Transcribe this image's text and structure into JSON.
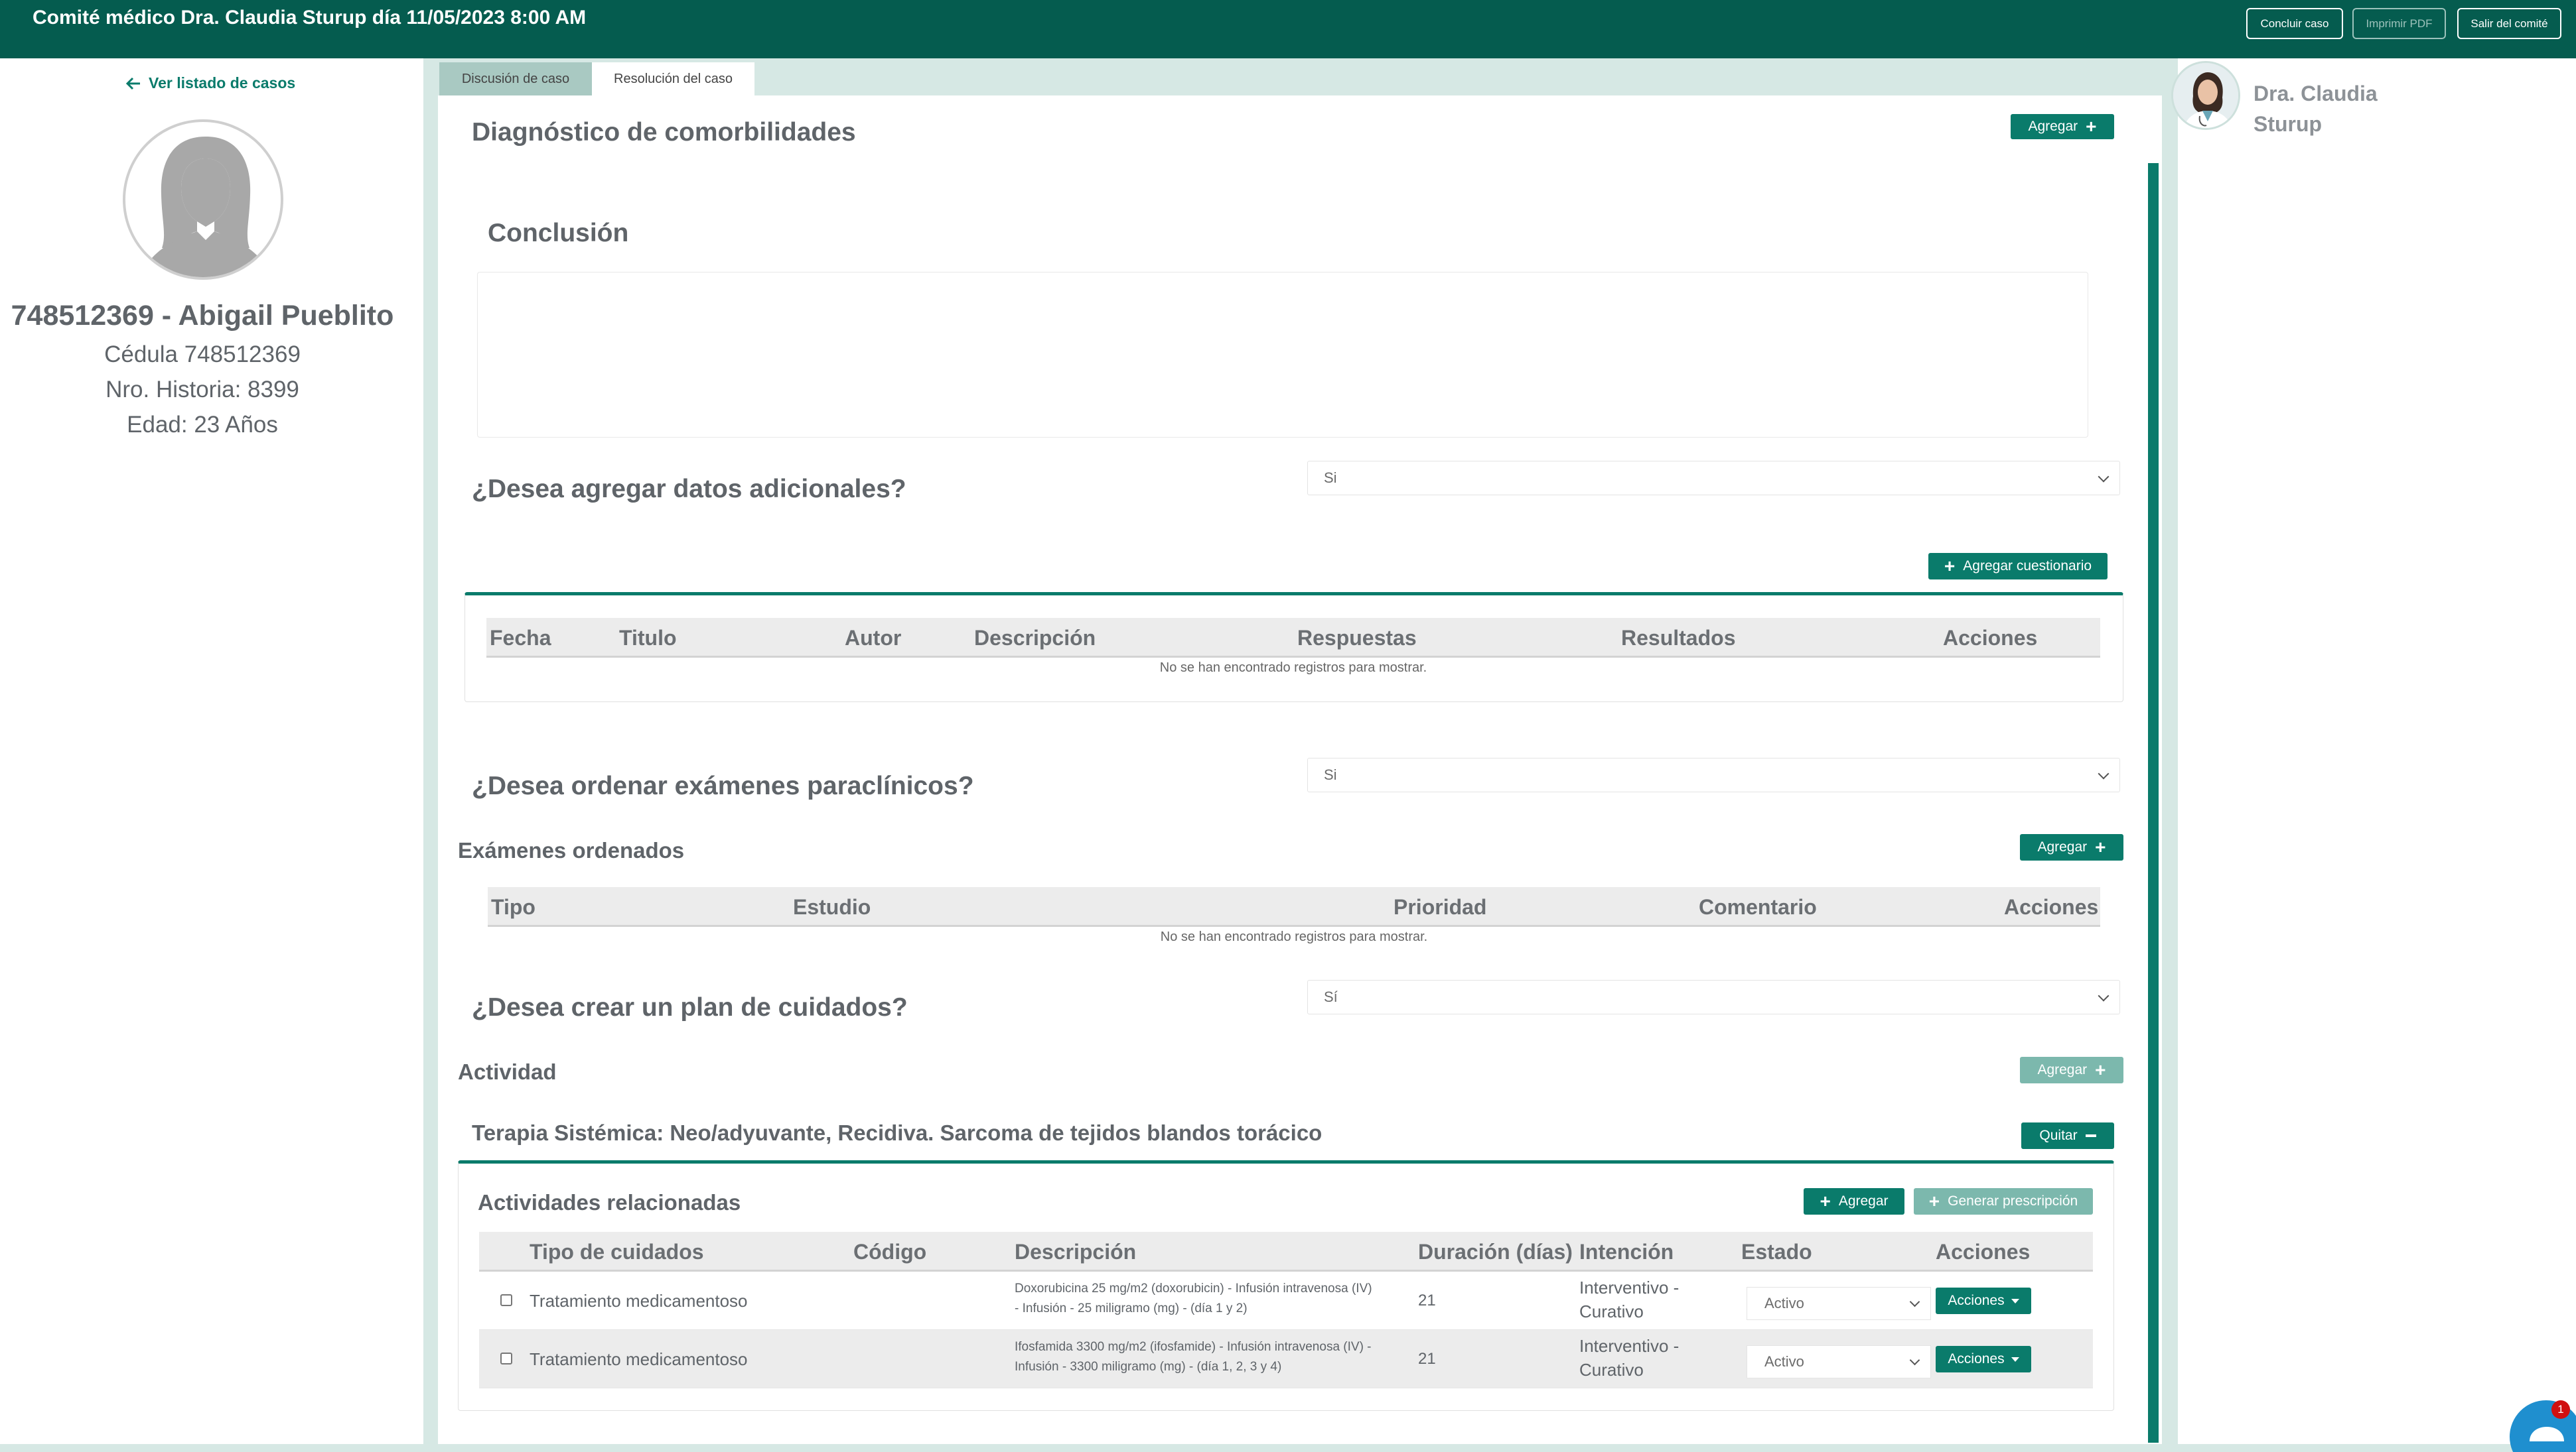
{
  "header": {
    "title": "Comité médico Dra. Claudia Sturup día 11/05/2023 8:00 AM",
    "buttons": {
      "conclude": "Concluir caso",
      "print": "Imprimir PDF",
      "exit": "Salir del comité"
    }
  },
  "left": {
    "back_link": "Ver listado de casos",
    "patient_name": "748512369 - Abigail Pueblito",
    "cedula": "Cédula 748512369",
    "historia": "Nro. Historia: 8399",
    "edad": "Edad: 23 Años"
  },
  "doctor": {
    "name_line1": "Dra. Claudia",
    "name_line2": "Sturup"
  },
  "tabs": [
    {
      "label": "Discusión de caso",
      "active": false
    },
    {
      "label": "Resolución del caso",
      "active": true
    }
  ],
  "main": {
    "comorbidities": {
      "title": "Diagnóstico de comorbilidades",
      "add": "Agregar"
    },
    "conclusion": {
      "title": "Conclusión",
      "value": ""
    },
    "additional": {
      "question": "¿Desea agregar datos adicionales?",
      "answer": "Si",
      "add_questionnaire": "Agregar cuestionario",
      "columns": [
        "Fecha",
        "Titulo",
        "Autor",
        "Descripción",
        "Respuestas",
        "Resultados",
        "Acciones"
      ],
      "empty": "No se han encontrado registros para mostrar."
    },
    "exams": {
      "question": "¿Desea ordenar exámenes paraclínicos?",
      "answer": "Si",
      "ordered_title": "Exámenes ordenados",
      "add": "Agregar",
      "columns": [
        "Tipo",
        "Estudio",
        "Prioridad",
        "Comentario",
        "Acciones"
      ],
      "empty": "No se han encontrado registros para mostrar."
    },
    "care_plan": {
      "question": "¿Desea crear un plan de cuidados?",
      "answer": "Sí",
      "activity_title": "Actividad",
      "add": "Agregar",
      "therapy_title": "Terapia Sistémica: Neo/adyuvante, Recidiva. Sarcoma de tejidos blandos torácico",
      "remove": "Quitar",
      "related": {
        "title": "Actividades relacionadas",
        "add": "Agregar",
        "generate": "Generar prescripción",
        "columns": [
          "Tipo de cuidados",
          "Código",
          "Descripción",
          "Duración (días)",
          "Intención",
          "Estado",
          "Acciones"
        ],
        "rows": [
          {
            "tipo": "Tratamiento medicamentoso",
            "codigo": "",
            "desc1": "Doxorubicina 25 mg/m2 (doxorubicin) - Infusión intravenosa (IV)",
            "desc2": "- Infusión - 25 miligramo (mg) - (día 1 y 2)",
            "duracion": "21",
            "intencion1": "Interventivo -",
            "intencion2": "Curativo",
            "estado": "Activo",
            "acciones": "Acciones"
          },
          {
            "tipo": "Tratamiento medicamentoso",
            "codigo": "",
            "desc1": "Ifosfamida 3300 mg/m2 (ifosfamide) - Infusión intravenosa (IV) -",
            "desc2": "Infusión - 3300 miligramo (mg) - (día 1, 2, 3 y 4)",
            "duracion": "21",
            "intencion1": "Interventivo -",
            "intencion2": "Curativo",
            "estado": "Activo",
            "acciones": "Acciones"
          }
        ]
      }
    }
  },
  "chat": {
    "badge": "1"
  },
  "colors": {
    "primary": "#055c4f",
    "accent": "#0a7b6b",
    "background": "#d6e8e4"
  }
}
